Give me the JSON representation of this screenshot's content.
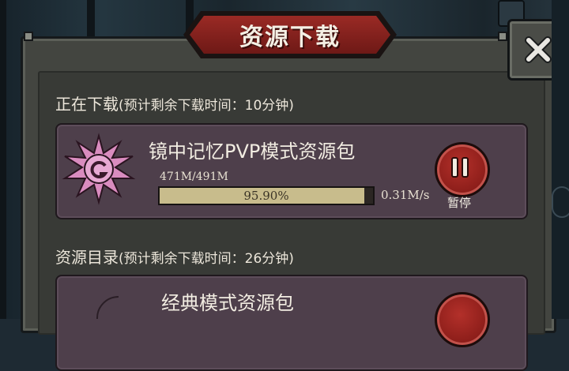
{
  "dialog": {
    "title": "资源下载",
    "close_icon": "close-x-icon"
  },
  "downloading": {
    "heading": "正在下载",
    "eta": "(预计剩余下载时间：10分钟)",
    "item": {
      "name": "镜中记忆PVP模式资源包",
      "icon": "thorn-swirl-icon",
      "size": "471M/491M",
      "progress_label": "95.90%",
      "progress": 0.959,
      "speed": "0.31M/s",
      "pause_label": "暂停",
      "pause_icon": "pause-icon"
    }
  },
  "catalog": {
    "heading": "资源目录",
    "eta": "(预计剩余下载时间：26分钟)",
    "items": [
      {
        "name": "经典模式资源包",
        "icon": "crescent-moon-icon"
      }
    ]
  },
  "colors": {
    "accent_red": "#9a2a25",
    "card_bg": "#4e3f4b",
    "progress_fill": "#c8bc8c"
  }
}
